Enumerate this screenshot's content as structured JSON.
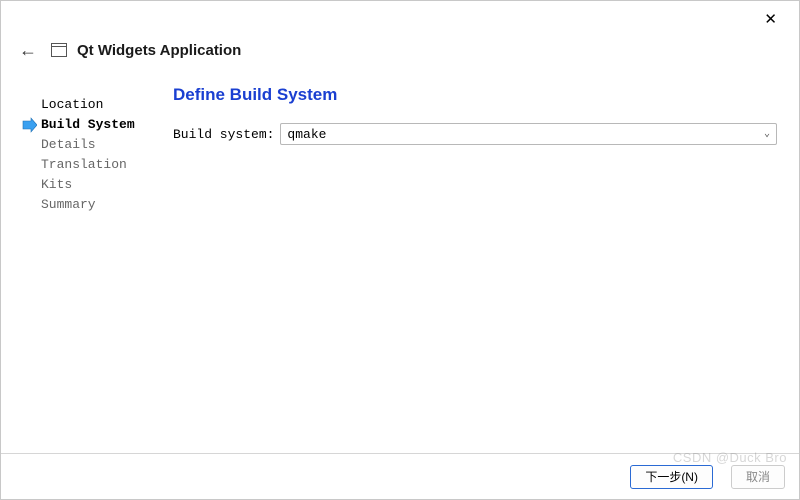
{
  "header": {
    "title": "Qt Widgets Application"
  },
  "sidebar": {
    "steps": [
      {
        "label": "Location",
        "state": "done"
      },
      {
        "label": "Build System",
        "state": "current"
      },
      {
        "label": "Details",
        "state": "pending"
      },
      {
        "label": "Translation",
        "state": "pending"
      },
      {
        "label": "Kits",
        "state": "pending"
      },
      {
        "label": "Summary",
        "state": "pending"
      }
    ]
  },
  "main": {
    "title": "Define Build System",
    "build_system_label": "Build system:",
    "build_system_value": "qmake"
  },
  "footer": {
    "next_label": "下一步(N)",
    "cancel_label": "取消"
  },
  "watermark": "CSDN @Duck Bro"
}
